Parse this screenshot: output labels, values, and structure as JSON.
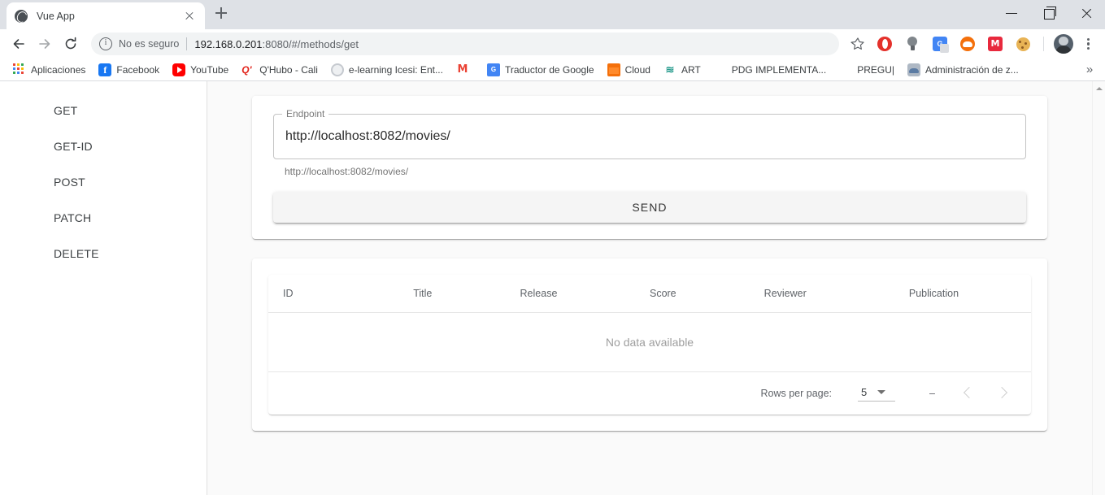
{
  "window": {
    "controls": {
      "minimize": "minimize-button",
      "maximize": "restore-button",
      "close": "close-button"
    }
  },
  "tab": {
    "title": "Vue App",
    "favicon": "globe-icon",
    "close_label": "",
    "new_tab_label": ""
  },
  "toolbar": {
    "back": "back-icon",
    "forward": "forward-icon",
    "reload": "reload-icon",
    "security_text": "No es seguro",
    "url_host": "192.168.0.201",
    "url_path": ":8080/#/methods/get",
    "url_full": "192.168.0.201:8080/#/methods/get",
    "bookmark": "star-icon",
    "extensions": [
      {
        "name": "opera-extension-icon"
      },
      {
        "name": "lightbulb-extension-icon"
      },
      {
        "name": "google-translate-extension-icon"
      },
      {
        "name": "cloud-extension-icon"
      },
      {
        "name": "mega-extension-icon"
      },
      {
        "name": "cookie-extension-icon"
      }
    ],
    "profile": "avatar-icon",
    "menu": "chrome-menu-icon"
  },
  "bookmarks": {
    "items": [
      {
        "label": "Aplicaciones",
        "icon": "apps-grid-icon"
      },
      {
        "label": "Facebook",
        "icon": "facebook-icon"
      },
      {
        "label": "YouTube",
        "icon": "youtube-icon"
      },
      {
        "label": "Q'Hubo - Cali",
        "icon": "qhubo-icon"
      },
      {
        "label": "e-learning Icesi: Ent...",
        "icon": "moodle-icon"
      },
      {
        "label": "",
        "icon": "gmail-icon"
      },
      {
        "label": "Traductor de Google",
        "icon": "google-translate-icon"
      },
      {
        "label": "Cloud",
        "icon": "cloud-box-icon"
      },
      {
        "label": "ART",
        "icon": "art-icon"
      },
      {
        "label": "PDG IMPLEMENTA...",
        "icon": "globe-icon"
      },
      {
        "label": "PREGU|",
        "icon": "globe-icon"
      },
      {
        "label": "Administración de z...",
        "icon": "zimbra-icon"
      }
    ],
    "overflow": "»"
  },
  "sidebar": {
    "items": [
      {
        "label": "GET"
      },
      {
        "label": "GET-ID"
      },
      {
        "label": "POST"
      },
      {
        "label": "PATCH"
      },
      {
        "label": "DELETE"
      }
    ]
  },
  "endpoint_card": {
    "field_label": "Endpoint",
    "field_value": "http://localhost:8082/movies/",
    "hint": "http://localhost:8082/movies/",
    "send_label": "SEND"
  },
  "table_card": {
    "columns": [
      "ID",
      "Title",
      "Release",
      "Score",
      "Reviewer",
      "Publication"
    ],
    "rows": [],
    "empty_text": "No data available",
    "footer": {
      "rows_per_page_label": "Rows per page:",
      "rows_per_page_value": "5",
      "range_text": "–",
      "prev_label": "prev-page",
      "next_label": "next-page"
    }
  },
  "colors": {
    "chrome_titlebar": "#dee1e6",
    "page_bg": "#fafafa",
    "sidebar_bg": "#ffffff",
    "button_bg": "#f5f5f5",
    "text_primary": "#3c4043",
    "text_muted": "#9e9e9e"
  }
}
